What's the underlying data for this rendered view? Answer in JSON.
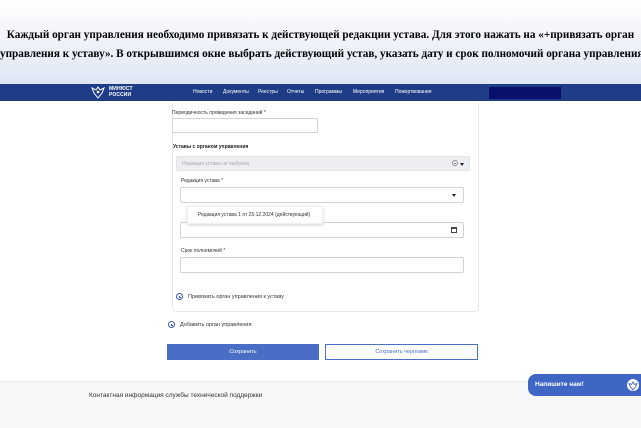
{
  "caption": {
    "line1": "Каждый орган управления необходимо привязать к действующей редакции устава. Для этого нажать на «+привязать орган",
    "line2": "управления к уставу». В открывшимся окне выбрать действующий устав, указать дату и срок полномочий органа управления."
  },
  "header": {
    "logo_line1": "МИНЮСТ",
    "logo_line2": "РОССИИ",
    "nav": [
      "Новости",
      "Документы",
      "Реестры",
      "Отчеты",
      "Программы",
      "Мероприятия",
      "Пожертвования"
    ],
    "colors": {
      "navbar": "#1f3d86",
      "search_box": "#08106b"
    }
  },
  "form": {
    "meeting_frequency_label": "Периодичность проведения заседаний *",
    "meeting_frequency_value": "",
    "charters_section_title": "Уставы с органом управления",
    "edition_select_placeholder": "Редакция устава не выбрана",
    "edition_field_label": "Редакция устава *",
    "edition_field_value": "",
    "dropdown_option": "Редакция устава 1 от 25.12.2024 (действующий)",
    "date_field_value": "",
    "term_label": "Срок полномочий *",
    "term_value": "",
    "link_bind_charter": "Привязать орган управления к уставу",
    "link_add_body": "Добавить орган управления"
  },
  "actions": {
    "save_label": "Сохранить",
    "save_draft_label": "Сохранить черновик",
    "accent": "#4a6ec5"
  },
  "footer": {
    "contact_text": "Контактная информация службы технической поддержки"
  },
  "chat": {
    "label": "Напишите нам!"
  }
}
